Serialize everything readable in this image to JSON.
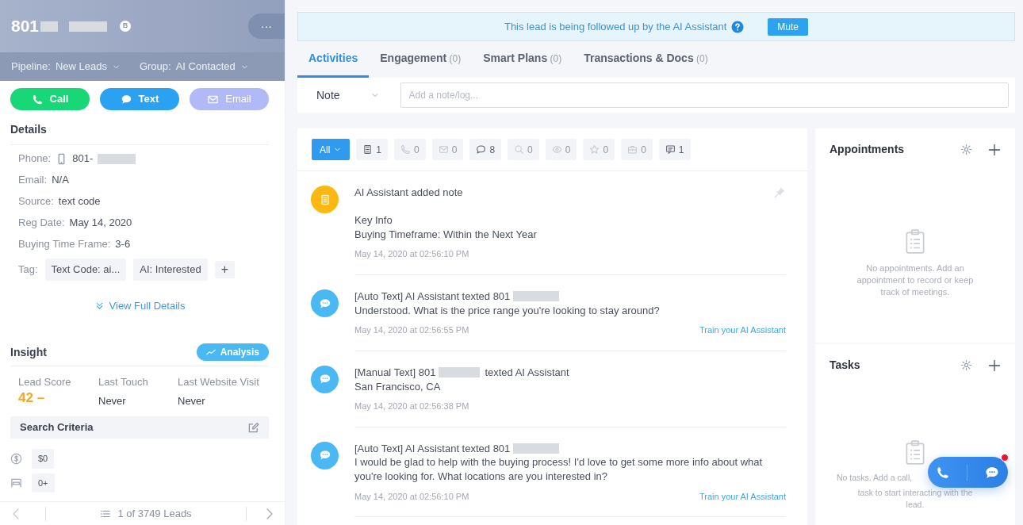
{
  "lead": {
    "name": "801",
    "badge": "B",
    "more": "···"
  },
  "pipeline": {
    "label": "Pipeline:",
    "value": "New Leads"
  },
  "group": {
    "label": "Group:",
    "value": "AI Contacted"
  },
  "actions": [
    {
      "kind": "call",
      "label": "Call",
      "disabled": false
    },
    {
      "kind": "text",
      "label": "Text",
      "disabled": false
    },
    {
      "kind": "email",
      "label": "Email",
      "disabled": true
    }
  ],
  "details": {
    "title": "Details",
    "fields": [
      {
        "kind": "phone",
        "label": "Phone:",
        "value": "801-",
        "redacted": true
      },
      {
        "kind": "plain",
        "label": "Email:",
        "value": "N/A",
        "redacted": false
      },
      {
        "kind": "plain",
        "label": "Source:",
        "value": "text code",
        "redacted": false
      },
      {
        "kind": "plain",
        "label": "Reg Date:",
        "value": "May 14, 2020",
        "redacted": false
      },
      {
        "kind": "plain",
        "label": "Buying Time Frame:",
        "value": "3-6",
        "redacted": false
      }
    ],
    "tags_label": "Tag:",
    "tags": [
      "Text Code: ai...",
      "AI: Interested"
    ],
    "add_tag": "+",
    "view_full": "View Full Details"
  },
  "insight": {
    "title": "Insight",
    "analysis": "Analysis",
    "stats": [
      {
        "kind": "score",
        "label": "Lead Score",
        "value": "42 –"
      },
      {
        "kind": "plain",
        "label": "Last Touch",
        "value": "Never"
      },
      {
        "kind": "plain",
        "label": "Last Website Visit",
        "value": "Never"
      }
    ],
    "search_criteria": "Search Criteria",
    "criteria": [
      {
        "kind": "price",
        "value": "$0"
      },
      {
        "kind": "beds",
        "value": "0+"
      }
    ]
  },
  "pager": {
    "label": "1 of 3749 Leads"
  },
  "banner": {
    "text": "This lead is being followed up by the AI Assistant",
    "button": "Mute"
  },
  "tabs": [
    {
      "label": "Activities",
      "selected": true
    },
    {
      "label": "Engagement",
      "count": "(0)",
      "selected": false
    },
    {
      "label": "Smart Plans",
      "count": "(0)",
      "selected": false
    },
    {
      "label": "Transactions & Docs",
      "count": "(0)",
      "selected": false
    }
  ],
  "note": {
    "type": "Note",
    "placeholder": "Add a note/log..."
  },
  "filters": [
    {
      "kind": "all",
      "label": "All",
      "selected": true,
      "disabled": false
    },
    {
      "kind": "note",
      "label": "1",
      "selected": false,
      "disabled": false
    },
    {
      "kind": "call",
      "label": "0",
      "selected": false,
      "disabled": true
    },
    {
      "kind": "email",
      "label": "0",
      "selected": false,
      "disabled": true
    },
    {
      "kind": "text",
      "label": "8",
      "selected": false,
      "disabled": false
    },
    {
      "kind": "search",
      "label": "0",
      "selected": false,
      "disabled": true
    },
    {
      "kind": "view",
      "label": "0",
      "selected": false,
      "disabled": true
    },
    {
      "kind": "star",
      "label": "0",
      "selected": false,
      "disabled": true
    },
    {
      "kind": "deal",
      "label": "0",
      "selected": false,
      "disabled": true
    },
    {
      "kind": "sms",
      "label": "1",
      "selected": false,
      "disabled": false
    }
  ],
  "activities": [
    {
      "kind": "note",
      "title": [
        "AI Assistant added note"
      ],
      "redacted": false,
      "body": [
        "Key Info",
        "Buying Timeframe: Within the Next Year"
      ],
      "time": "May 14, 2020 at 02:56:10 PM",
      "pinned": true
    },
    {
      "kind": "text",
      "title": [
        "[Auto Text] AI Assistant texted 801"
      ],
      "redacted": true,
      "body": [
        "Understood. What is the price range you're looking to stay around?"
      ],
      "time": "May 14, 2020 at 02:56:55 PM",
      "link": "Train your AI Assistant",
      "pinned": false
    },
    {
      "kind": "text",
      "title": [
        "[Manual Text] 801",
        "texted AI Assistant"
      ],
      "redacted": true,
      "body": [
        "San Francisco, CA"
      ],
      "time": "May 14, 2020 at 02:56:38 PM",
      "pinned": false
    },
    {
      "kind": "text",
      "title": [
        "[Auto Text] AI Assistant texted 801"
      ],
      "redacted": true,
      "body": [
        "I would be glad to help with the buying process! I'd love to get some more info about what you're looking for. What locations are you interested in?"
      ],
      "time": "May 14, 2020 at 02:56:10 PM",
      "link": "Train your AI Assistant",
      "pinned": false
    }
  ],
  "appointments": {
    "title": "Appointments",
    "empty": [
      "No appointments. Add an",
      "appointment to record or keep",
      "track of meetings."
    ]
  },
  "tasks": {
    "title": "Tasks",
    "empty": [
      "No tasks. Add a call,",
      "task to start interacting with the",
      "lead."
    ]
  },
  "dock": {
    "unread": true
  }
}
